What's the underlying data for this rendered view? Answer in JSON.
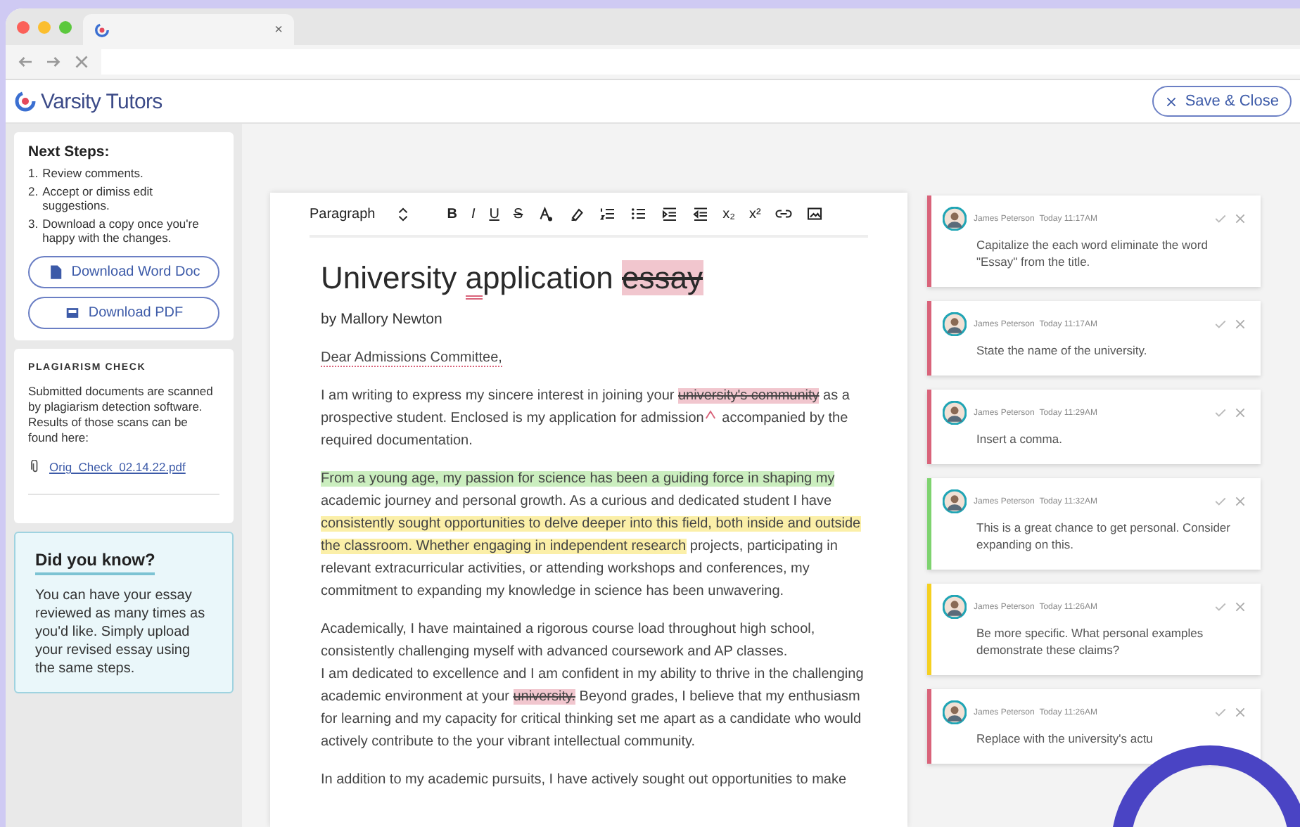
{
  "browser": {
    "tab_close": "×"
  },
  "header": {
    "logo": "Varsity Tutors",
    "save_button": "Save & Close"
  },
  "next_steps": {
    "title": "Next Steps:",
    "steps": [
      {
        "number": "1.",
        "text": "Review comments."
      },
      {
        "number": "2.",
        "text": "Accept or dimiss edit suggestions."
      },
      {
        "number": "3.",
        "text": "Download a copy once you're happy with the changes."
      }
    ],
    "buttons": [
      {
        "kind": "word",
        "label": "Download Word Doc"
      },
      {
        "kind": "pdf",
        "label": "Download PDF"
      }
    ]
  },
  "plagiarism": {
    "title": "PLAGIARISM CHECK",
    "text": "Submitted documents are scanned by plagiarism detection software. Results of those scans can be found here:",
    "file": "Orig_Check_02.14.22.pdf"
  },
  "tip": {
    "title": "Did you know?",
    "text": "You can have your essay reviewed as many times as you'd like. Simply upload your revised essay using the same steps."
  },
  "toolbar": {
    "style": "Paragraph",
    "buttons": [
      {
        "kind": "bold",
        "label": "B"
      },
      {
        "kind": "italic",
        "label": "I"
      },
      {
        "kind": "underline",
        "label": "U"
      },
      {
        "kind": "strike",
        "label": "S"
      },
      {
        "kind": "text-color"
      },
      {
        "kind": "highlight"
      },
      {
        "kind": "ordered-list"
      },
      {
        "kind": "bullet-list"
      },
      {
        "kind": "indent"
      },
      {
        "kind": "outdent"
      },
      {
        "kind": "script",
        "label": "x₂"
      },
      {
        "kind": "script",
        "label": "x²"
      },
      {
        "kind": "link"
      },
      {
        "kind": "image"
      }
    ]
  },
  "document": {
    "title": [
      {
        "kind": "plain",
        "text": "University "
      },
      {
        "kind": "underlined",
        "text": "a"
      },
      {
        "kind": "plain",
        "text": "pplication "
      },
      {
        "kind": "deleted",
        "text": "essay"
      }
    ],
    "byline": "by Mallory Newton",
    "paragraphs": [
      {
        "segments": [
          {
            "kind": "dotted",
            "text": "Dear Admissions Committee,"
          }
        ]
      },
      {
        "segments": [
          {
            "kind": "plain",
            "text": "I am writing to express my sincere interest in joining your "
          },
          {
            "kind": "deleted",
            "text": "university's community"
          },
          {
            "kind": "plain",
            "text": " as a prospective student. Enclosed is my application for admission"
          },
          {
            "kind": "caret"
          },
          {
            "kind": "plain",
            "text": " accompanied by the required documentation."
          }
        ]
      },
      {
        "segments": [
          {
            "kind": "green",
            "text": "From a young age, my passion for science has been a guiding force in shaping my"
          },
          {
            "kind": "plain",
            "text": " academic journey and personal growth. As a curious and dedicated student I have "
          },
          {
            "kind": "yellow",
            "text": "consistently sought opportunities to delve deeper into this field, both inside and outside the classroom. Whether engaging in independent research"
          },
          {
            "kind": "plain",
            "text": " projects, participating in relevant extracurricular activities, or attending workshops and conferences, my commitment to expanding my knowledge in science has been unwavering."
          }
        ]
      },
      {
        "segments": [
          {
            "kind": "line",
            "text": "Academically, I have maintained a rigorous course load throughout high school, consistently challenging myself with advanced coursework and AP classes."
          },
          {
            "kind": "plain",
            "text": "I am dedicated to excellence and I am confident in my ability to thrive in the challenging academic environment at your "
          },
          {
            "kind": "deleted",
            "text": "university."
          },
          {
            "kind": "plain",
            "text": " Beyond grades, I believe that my enthusiasm for learning and my capacity for critical thinking set me apart as a candidate who would actively contribute to the your vibrant intellectual community."
          }
        ]
      },
      {
        "segments": [
          {
            "kind": "plain",
            "text": "In addition to my academic pursuits, I have actively sought out opportunities to make"
          }
        ]
      }
    ]
  },
  "comments": [
    {
      "color": "#d9637a",
      "author": "James Peterson",
      "time": "Today 11:17AM",
      "text": "Capitalize the each word eliminate the word \"Essay\" from the title."
    },
    {
      "color": "#d9637a",
      "author": "James Peterson",
      "time": "Today 11:17AM",
      "text": "State the name of the university."
    },
    {
      "color": "#d9637a",
      "author": "James Peterson",
      "time": "Today 11:29AM",
      "text": "Insert a comma."
    },
    {
      "color": "#7ed36f",
      "author": "James Peterson",
      "time": "Today 11:32AM",
      "text": "This is a great chance to get personal. Consider expanding on this."
    },
    {
      "color": "#f5d020",
      "author": "James Peterson",
      "time": "Today 11:26AM",
      "text": "Be more specific. What personal examples demonstrate these claims?"
    },
    {
      "color": "#d9637a",
      "author": "James Peterson",
      "time": "Today 11:26AM",
      "text": "Replace with the university's actu"
    }
  ]
}
